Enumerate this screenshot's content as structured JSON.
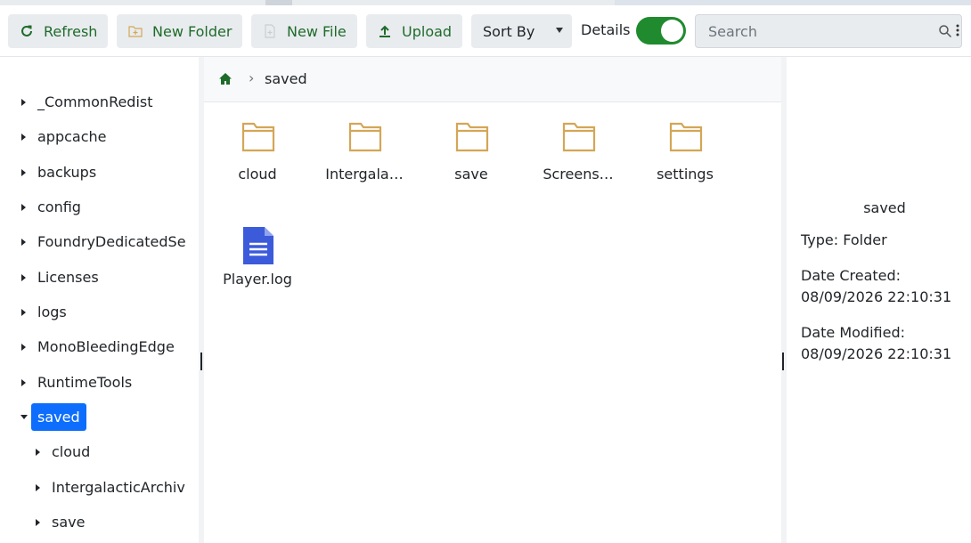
{
  "toolbar": {
    "refresh_label": "Refresh",
    "new_folder_label": "New Folder",
    "new_file_label": "New File",
    "upload_label": "Upload",
    "sort_label": "Sort By",
    "details_label": "Details",
    "details_enabled": true,
    "search_placeholder": "Search",
    "search_value": ""
  },
  "colors": {
    "accent_green": "#1f6b2a",
    "toggle_on": "#1f8b2e",
    "selected_blue": "#0d6efd",
    "folder_tan": "#d4a656",
    "file_blue": "#3b5bdb"
  },
  "sidebar": {
    "items": [
      {
        "label": "_CommonRedist",
        "expanded": false,
        "level": 0
      },
      {
        "label": "appcache",
        "expanded": false,
        "level": 0
      },
      {
        "label": "backups",
        "expanded": false,
        "level": 0
      },
      {
        "label": "config",
        "expanded": false,
        "level": 0
      },
      {
        "label": "FoundryDedicatedSe",
        "expanded": false,
        "level": 0
      },
      {
        "label": "Licenses",
        "expanded": false,
        "level": 0
      },
      {
        "label": "logs",
        "expanded": false,
        "level": 0
      },
      {
        "label": "MonoBleedingEdge",
        "expanded": false,
        "level": 0
      },
      {
        "label": "RuntimeTools",
        "expanded": false,
        "level": 0
      },
      {
        "label": "saved",
        "expanded": true,
        "level": 0,
        "selected": true
      },
      {
        "label": "cloud",
        "expanded": false,
        "level": 1
      },
      {
        "label": "IntergalacticArchiv",
        "expanded": false,
        "level": 1
      },
      {
        "label": "save",
        "expanded": false,
        "level": 1
      }
    ]
  },
  "breadcrumb": {
    "separator": "›",
    "current": "saved"
  },
  "files": [
    {
      "name": "cloud",
      "type": "folder"
    },
    {
      "name": "Intergala…",
      "type": "folder"
    },
    {
      "name": "save",
      "type": "folder"
    },
    {
      "name": "Screens…",
      "type": "folder"
    },
    {
      "name": "settings",
      "type": "folder"
    },
    {
      "name": "Player.log",
      "type": "file"
    }
  ],
  "details": {
    "name": "saved",
    "type_line": "Type: Folder",
    "created_label": "Date Created:",
    "created_value": "08/09/2026 22:10:31",
    "modified_label": "Date Modified:",
    "modified_value": "08/09/2026 22:10:31"
  }
}
